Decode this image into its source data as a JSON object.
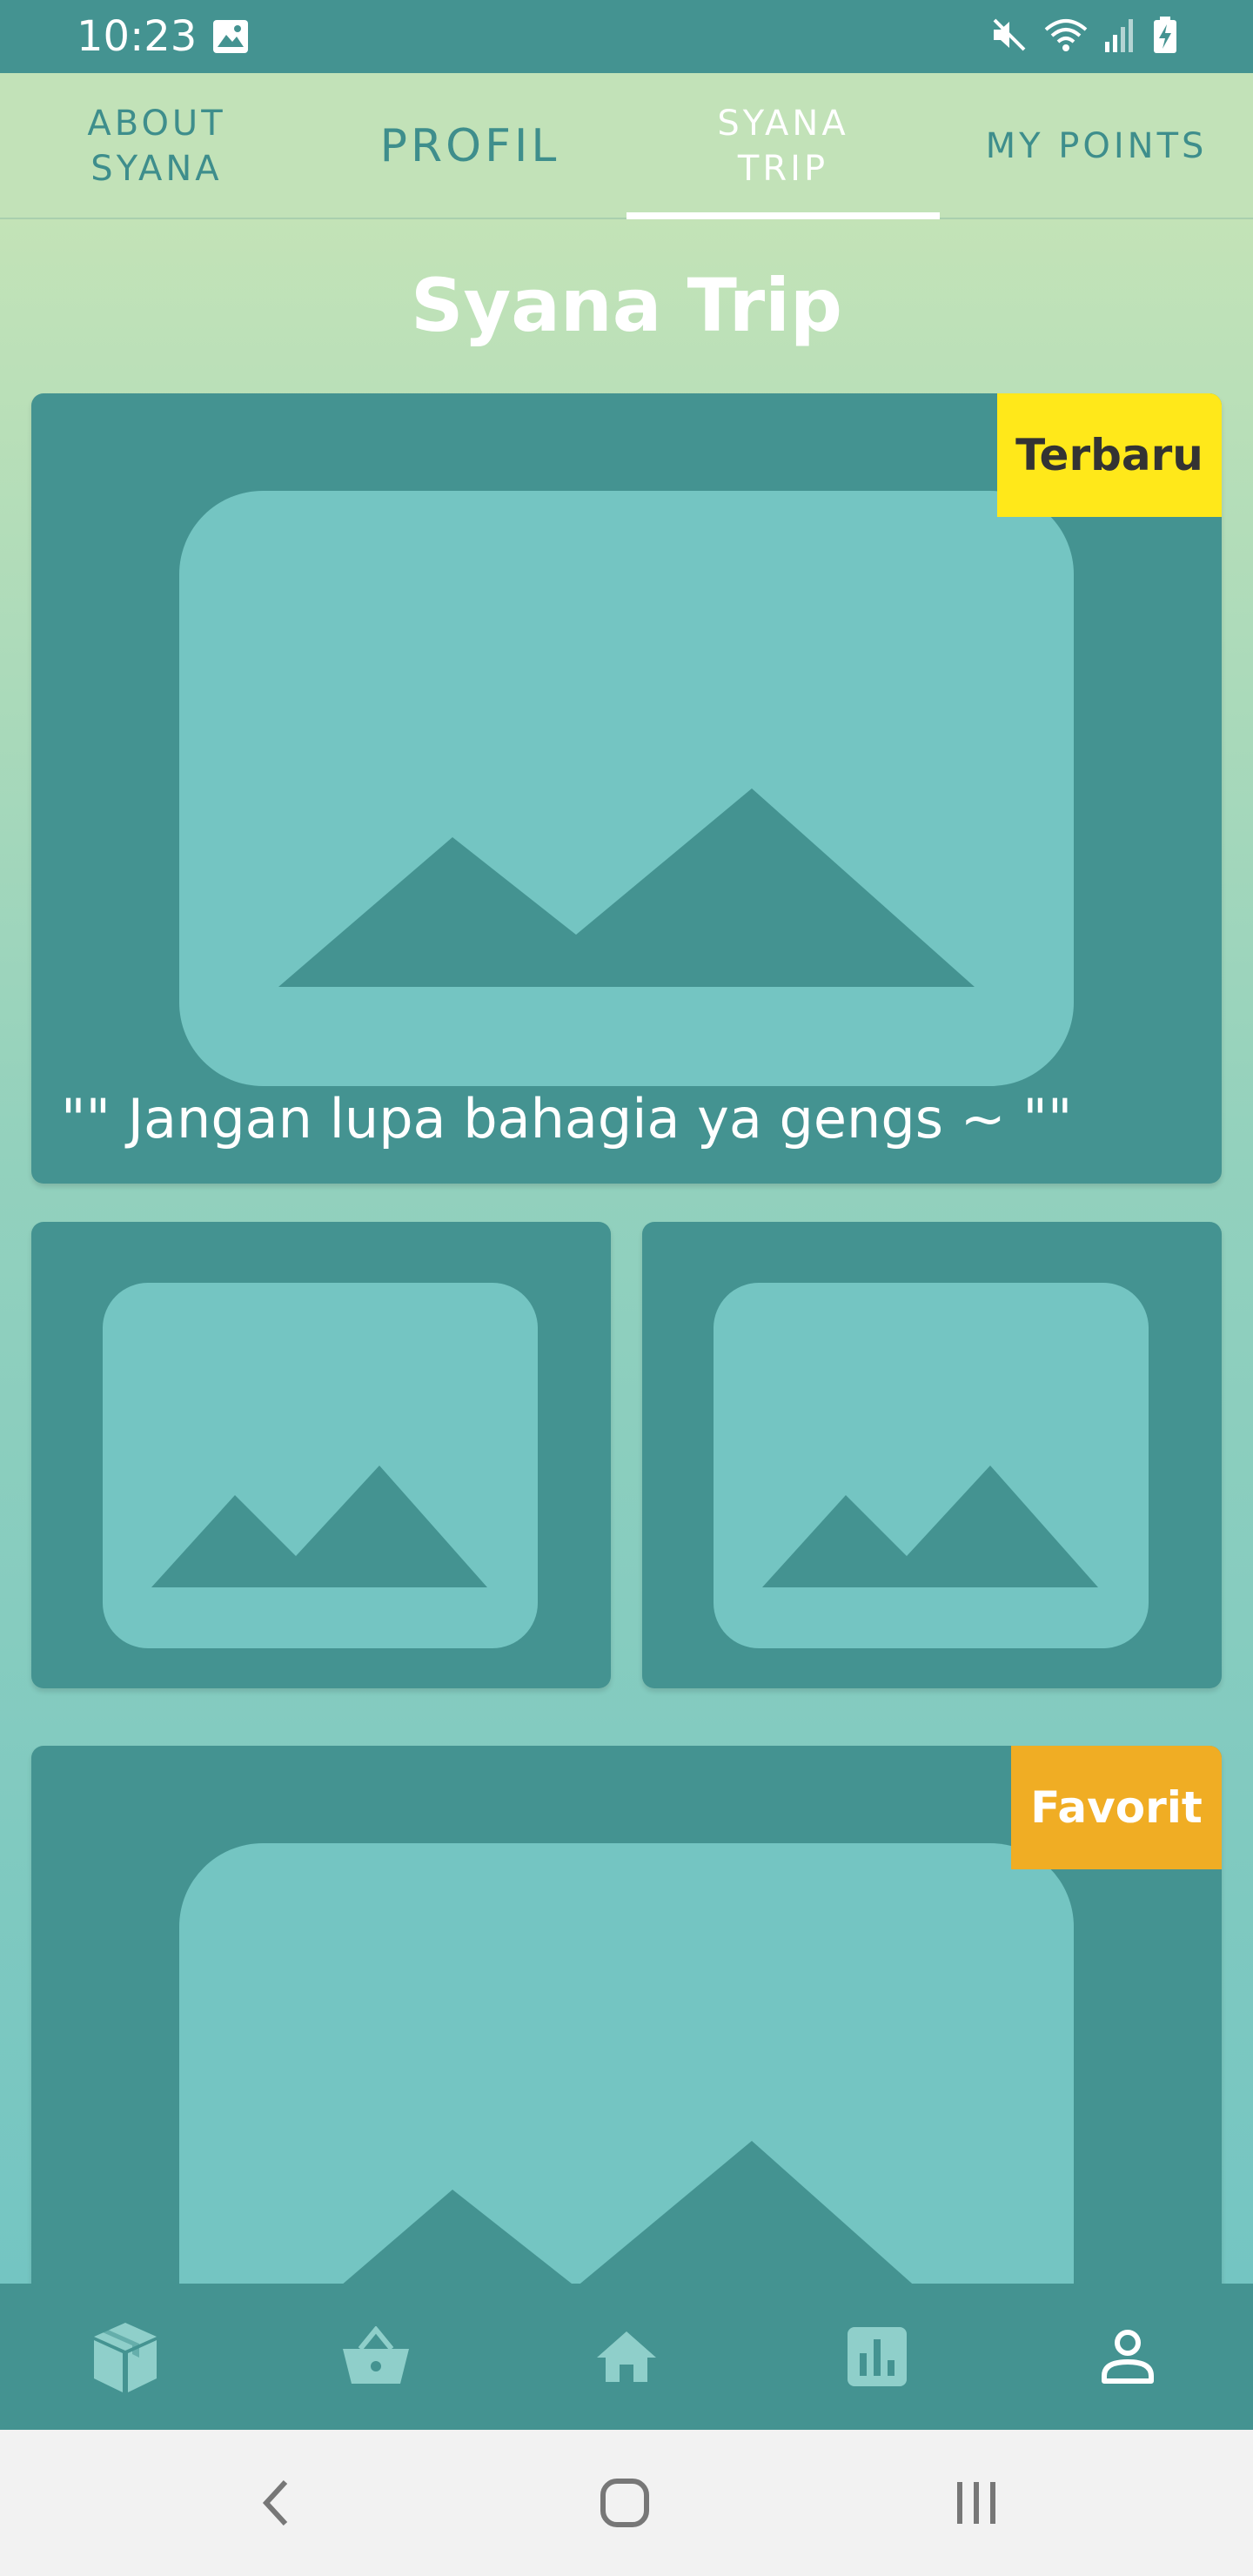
{
  "status_bar": {
    "time": "10:23",
    "icons": [
      "gallery-icon",
      "mute-icon",
      "wifi-icon",
      "signal-icon",
      "battery-charging-icon"
    ]
  },
  "tabs": [
    {
      "label": "ABOUT SYANA",
      "line1": "ABOUT",
      "line2": "SYANA",
      "active": false
    },
    {
      "label": "PROFIL",
      "active": false
    },
    {
      "label": "SYANA TRIP",
      "line1": "SYANA",
      "line2": "TRIP",
      "active": true
    },
    {
      "label": "MY POINTS",
      "active": false
    }
  ],
  "page": {
    "title": "Syana Trip"
  },
  "cards": {
    "featured": {
      "badge": "Terbaru",
      "caption": "\"\" Jangan lupa bahagia ya gengs ~ \"\""
    },
    "favorite": {
      "badge": "Favorit"
    }
  },
  "bottom_nav": [
    {
      "icon": "package-icon",
      "active": false
    },
    {
      "icon": "basket-icon",
      "active": false
    },
    {
      "icon": "home-icon",
      "active": false
    },
    {
      "icon": "chart-icon",
      "active": false
    },
    {
      "icon": "person-icon",
      "active": true
    }
  ],
  "system_nav": [
    "back-icon",
    "home-circle-icon",
    "recents-icon"
  ],
  "colors": {
    "primary": "#449391",
    "tab_background": "#c2e2b8",
    "placeholder": "#74c5c2",
    "badge_new": "#ffe81a",
    "badge_favorite": "#f0ad24",
    "nav_inactive": "#8fcfca"
  }
}
